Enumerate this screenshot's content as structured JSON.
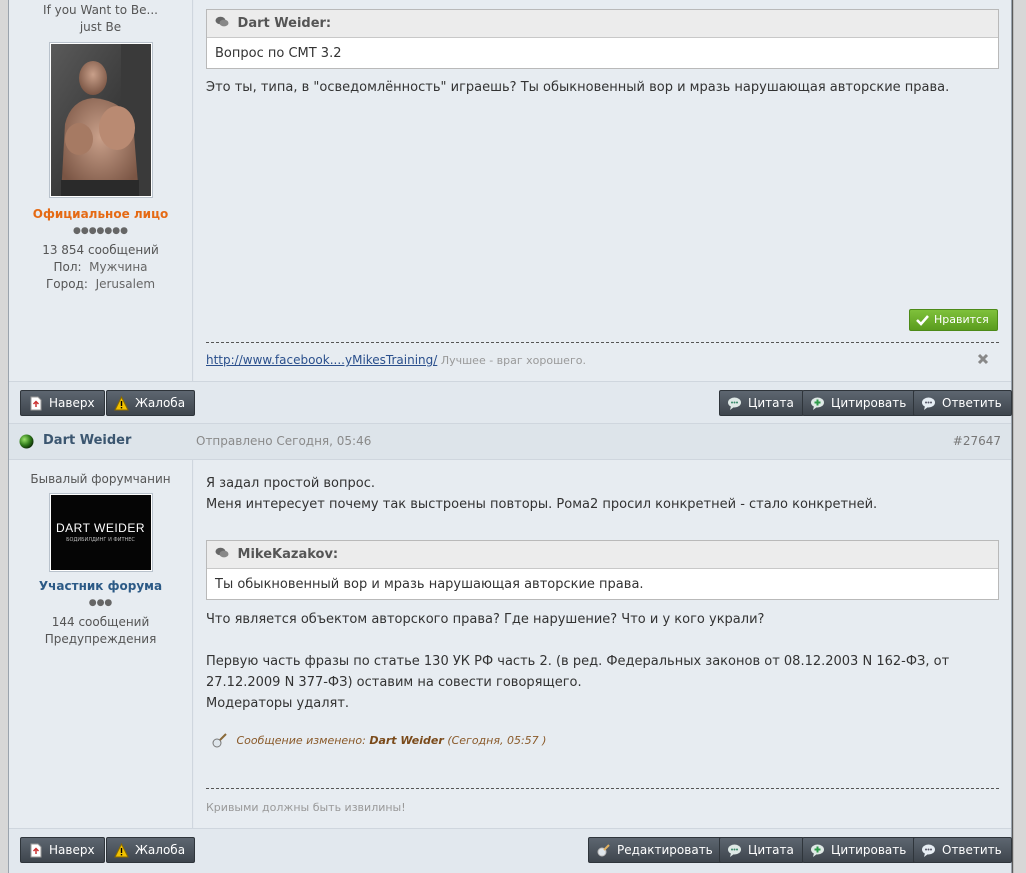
{
  "post1": {
    "sidebar": {
      "title": "If you Want to Be... just Be",
      "rank": "Официальное лицо",
      "pips": "●●●●●●●",
      "posts_count": "13 854 сообщений",
      "gender_label": "Пол:",
      "gender_value": "Мужчина",
      "city_label": "Город:",
      "city_value": "Jerusalem"
    },
    "quote": {
      "author": "Dart Weider:",
      "text": "Вопрос по СМТ 3.2"
    },
    "text": "Это ты, типа, в \"осведомлённость\" играешь? Ты обыкновенный вор и мразь нарушающая авторские права.",
    "like_label": "Нравится",
    "signature_link": "http://www.facebook....yMikesTraining/",
    "signature_text": "Лучшее - враг хорошего.",
    "buttons": {
      "top": "Наверх",
      "report": "Жалоба",
      "quote": "Цитата",
      "multiquote": "Цитировать",
      "reply": "Ответить"
    }
  },
  "post2": {
    "author": "Dart Weider",
    "posted": "Отправлено Сегодня, 05:46",
    "post_number": "#27647",
    "sidebar": {
      "title": "Бывалый форумчанин",
      "avatar_text": "DART WEIDER",
      "avatar_subtext": "БОДИБИЛДИНГ И ФИТНЕС",
      "rank": "Участник форума",
      "pips": "●●●",
      "posts_count": "144 сообщений",
      "warnings": "Предупреждения"
    },
    "text_lines": [
      "Я задал простой вопрос.",
      "Меня интересует почему так выстроены повторы. Рома2 просил конкретней - стало конкретней."
    ],
    "quote": {
      "author": "MikeKazakov:",
      "text": "Ты обыкновенный вор и мразь нарушающая авторские права."
    },
    "after_quote": "Что является объектом авторского права? Где нарушение? Что и у кого украли?",
    "paragraph2_lines": [
      "Первую часть фразы по статье 130 УК РФ часть 2. (в ред. Федеральных законов от 08.12.2003 N 162-ФЗ, от",
      "27.12.2009 N 377-ФЗ) оставим на совести говорящего.",
      "Модераторы удалят."
    ],
    "edited_prefix": "Сообщение изменено:",
    "edited_by": "Dart Weider",
    "edited_time": "(Сегодня, 05:57 )",
    "signature_text": "Кривыми должны быть извилины!",
    "buttons": {
      "top": "Наверх",
      "report": "Жалоба",
      "edit": "Редактировать",
      "quote": "Цитата",
      "multiquote": "Цитировать",
      "reply": "Ответить"
    }
  }
}
